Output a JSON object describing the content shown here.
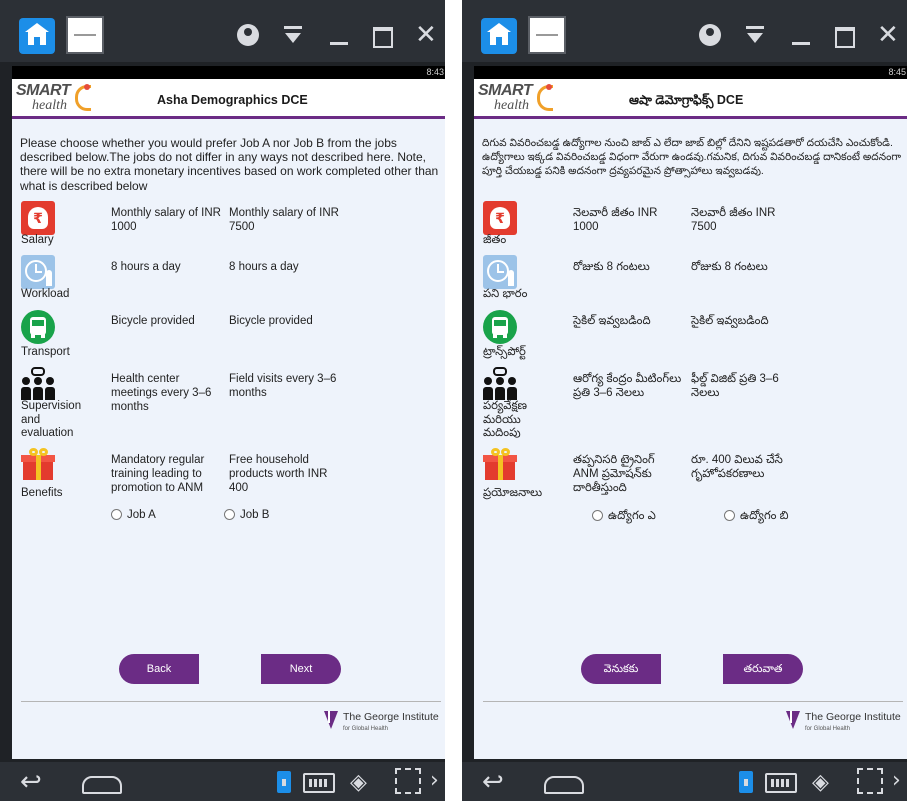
{
  "emulator": {
    "accent_color": "#6b2c85",
    "title_bar_icons": [
      "home-icon",
      "app-thumbnail",
      "account-icon",
      "download-icon",
      "minimize-icon",
      "maximize-icon",
      "close-icon"
    ],
    "close_glyph": "✕",
    "nav_icons": [
      "back-icon",
      "home-outline-icon",
      "phone-icon",
      "keyboard-icon",
      "eye-off-icon",
      "fullscreen-icon",
      "more-icon"
    ]
  },
  "left": {
    "status_time": "8:43",
    "app_logo": {
      "smart": "SMART",
      "health": "health"
    },
    "title": "Asha Demographics DCE",
    "intro": "Please choose whether you would prefer Job A nor Job B from the jobs described below.The jobs do not differ in any ways not described here. Note, there will be no extra monetary incentives based on work completed other than what is described below",
    "rows": [
      {
        "label": "Salary",
        "a": "Monthly salary of INR 1000",
        "b": "Monthly salary of INR 7500"
      },
      {
        "label": "Workload",
        "a": "8 hours a day",
        "b": "8 hours a day"
      },
      {
        "label": "Transport",
        "a": "Bicycle provided",
        "b": "Bicycle provided"
      },
      {
        "label": "Supervision and evaluation",
        "a": "Health center meetings every 3–6 months",
        "b": "Field visits every 3–6 months"
      },
      {
        "label": "Benefits",
        "a": "Mandatory regular training leading to promotion to ANM",
        "b": "Free household products worth INR 400"
      }
    ],
    "options": {
      "a": "Job A",
      "b": "Job B"
    },
    "back": "Back",
    "next": "Next",
    "footer": {
      "name": "The George Institute",
      "sub": "for Global Health"
    }
  },
  "right": {
    "status_time": "8:45",
    "app_logo": {
      "smart": "SMART",
      "health": "health"
    },
    "title": "ఆషా డెమోగ్రాఫిక్స్ DCE",
    "intro": "దిగువ వివరించబడ్డ ఉద్యోగాల నుంచి జాబ్ ఎ లేదా జాబ్ బిల్లో దేనిని ఇష్టపడతారో దయచేసి ఎంచుకోండి. ఉద్యోగాలు ఇక్కడ వివరించబడ్డ విధంగా వేరుగా ఉండవు.గమనిక, దిగువ వివరించబడ్డ దానికంటే అదనంగా పూర్తి చేయబడ్డ పనికి అదనంగా ద్రవ్యపరమైన ప్రోత్సాహాలు ఇవ్వబడవు.",
    "rows": [
      {
        "label": "జీతం",
        "a": "నెలవారీ జీతం INR 1000",
        "b": "నెలవారీ జీతం INR 7500"
      },
      {
        "label": "పని భారం",
        "a": "రోజుకు 8 గంటలు",
        "b": "రోజుకు 8 గంటలు"
      },
      {
        "label": "ట్రాన్స్‌పోర్ట్",
        "a": "సైకిల్ ఇవ్వబడింది",
        "b": "సైకిల్ ఇవ్వబడింది"
      },
      {
        "label": "పర్యవేక్షణ మరియు మదింపు",
        "a": "ఆరోగ్య కేంద్రం మీటింగ్‌లు ప్రతి 3–6 నెలలు",
        "b": "ఫీల్డ్ విజిట్ ప్రతి 3–6 నెలలు"
      },
      {
        "label": "ప్రయోజనాలు",
        "a": "తప్పనిసరి ట్రైనింగ్ ANM ప్రమోషన్‌కు దారితీస్తుంది",
        "b": "రూ. 400 విలువ చేసే గృహోపకరణాలు"
      }
    ],
    "options": {
      "a": "ఉద్యోగం ఎ",
      "b": "ఉద్యోగం బి"
    },
    "back": "వెనుకకు",
    "next": "తరువాత",
    "footer": {
      "name": "The George Institute",
      "sub": "for Global Health"
    }
  }
}
